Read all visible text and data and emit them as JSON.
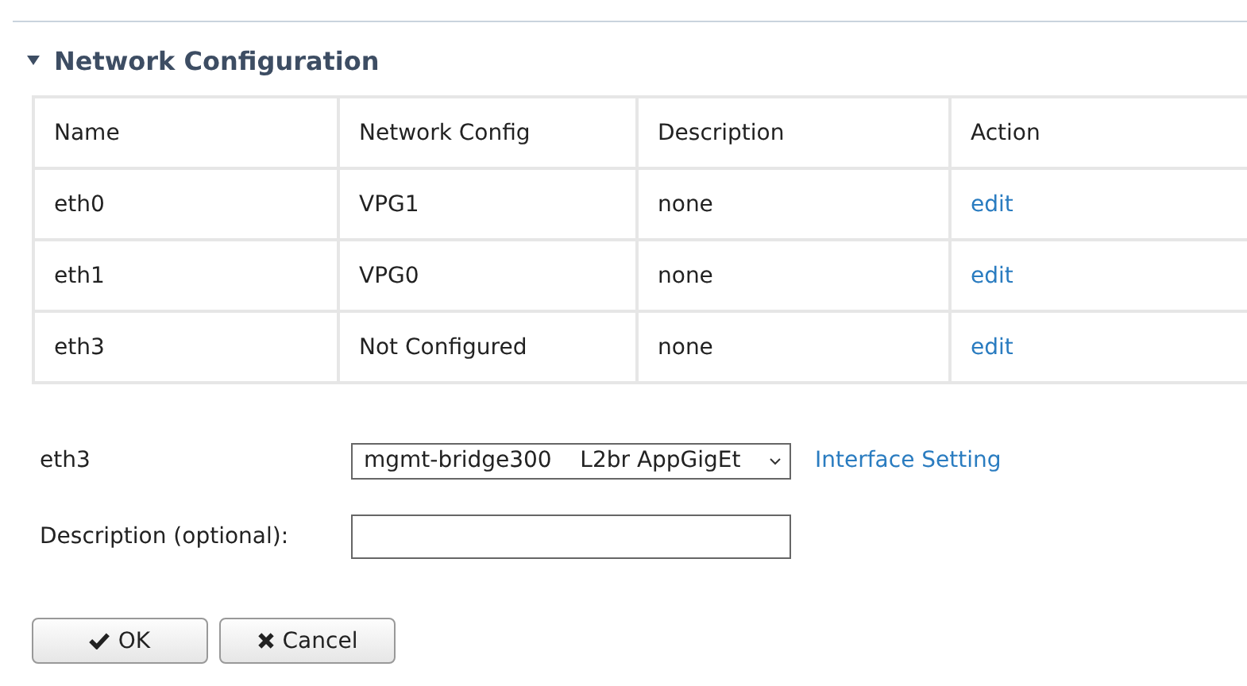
{
  "section": {
    "title": "Network Configuration",
    "expanded": true
  },
  "table": {
    "columns": [
      "Name",
      "Network Config",
      "Description",
      "Action"
    ],
    "rows": [
      {
        "name": "eth0",
        "network_config": "VPG1",
        "description": "none",
        "action": "edit"
      },
      {
        "name": "eth1",
        "network_config": "VPG0",
        "description": "none",
        "action": "edit"
      },
      {
        "name": "eth3",
        "network_config": "Not Configured",
        "description": "none",
        "action": "edit"
      }
    ]
  },
  "form": {
    "interface_label": "eth3",
    "interface_select": "mgmt-bridge300    L2br AppGigEt",
    "interface_link": "Interface Setting",
    "description_label": "Description (optional):"
  },
  "buttons": [
    {
      "kind": "ok",
      "label": "OK"
    },
    {
      "kind": "cancel",
      "label": "Cancel"
    }
  ]
}
